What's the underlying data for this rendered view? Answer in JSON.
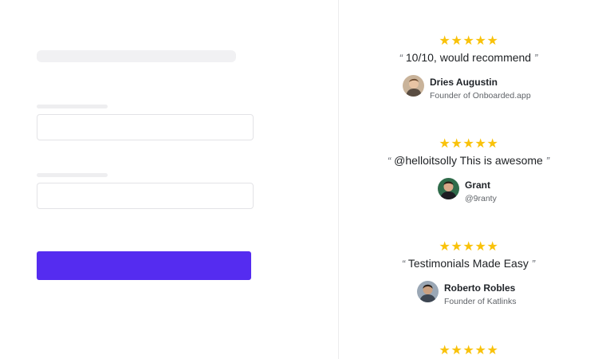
{
  "testimonials": [
    {
      "rating": 5,
      "quote": "10/10, would recommend",
      "name": "Dries Augustin",
      "subtitle": "Founder of Onboarded.app"
    },
    {
      "rating": 5,
      "quote": "@helloitsolly This is awesome",
      "name": "Grant",
      "subtitle": "@9ranty"
    },
    {
      "rating": 5,
      "quote": "Testimonials Made Easy",
      "name": "Roberto Robles",
      "subtitle": "Founder of Katlinks"
    },
    {
      "rating": 5
    }
  ],
  "quote_open": "“",
  "quote_close": "”",
  "colors": {
    "accent": "#552cf0",
    "star": "#f9c20a",
    "skeleton": "#f1f1f3",
    "border": "#e3e3e6"
  }
}
